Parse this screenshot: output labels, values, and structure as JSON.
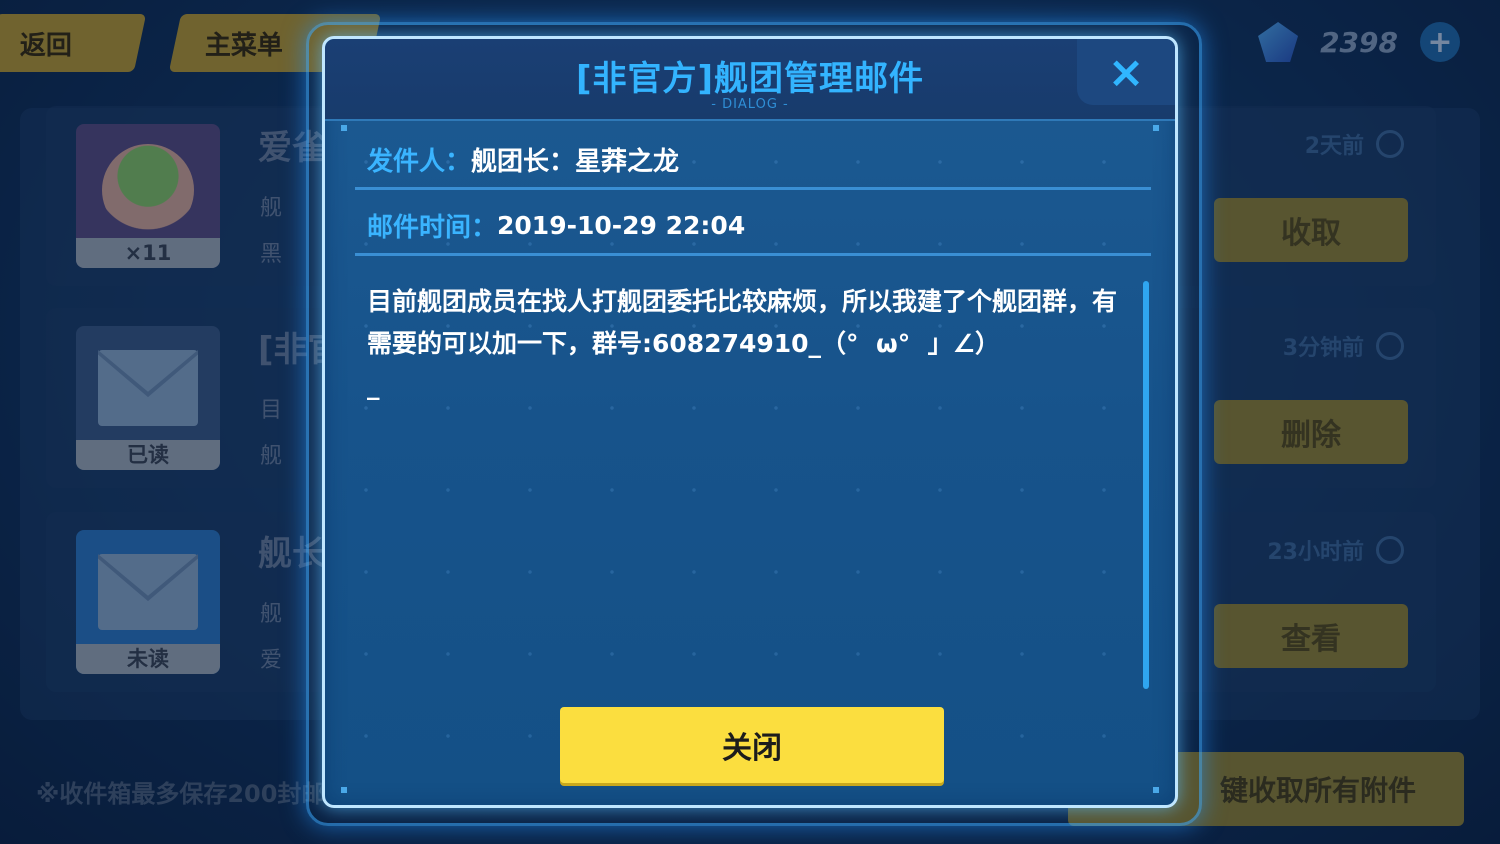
{
  "top_bar": {
    "back_label": "返回",
    "home_label": "主菜单",
    "currency_amount": "2398"
  },
  "mail_list": {
    "rows": [
      {
        "title": "爱雀",
        "thumb_caption": "×11",
        "time": "2天前",
        "action": "收取",
        "meta1": "舰",
        "meta2": "黑"
      },
      {
        "title": "[非官",
        "thumb_caption": "已读",
        "time": "3分钟前",
        "action": "删除",
        "meta1": "目",
        "meta2": "舰"
      },
      {
        "title": "舰长",
        "thumb_caption": "未读",
        "time": "23小时前",
        "action": "查看",
        "meta1": "舰",
        "meta2": "爱"
      }
    ],
    "footer_note": "※收件箱最多保存200封邮",
    "collect_all_label": "键收取所有附件"
  },
  "dialog": {
    "title": "[非官方]舰团管理邮件",
    "subtitle": "- DIALOG -",
    "close_icon": "×",
    "sender_label": "发件人：",
    "sender_value": "舰团长：星莽之龙",
    "time_label": "邮件时间：",
    "time_value": "2019-10-29 22:04",
    "body": "目前舰团成员在找人打舰团委托比较麻烦，所以我建了个舰团群，有需要的可以加一下，群号:608274910_（°  ω°  」∠）\n_",
    "close_button_label": "关闭"
  },
  "colors": {
    "accent_blue": "#33b4ff",
    "button_yellow": "#fbde3f",
    "dialog_bg": "#17538b"
  }
}
